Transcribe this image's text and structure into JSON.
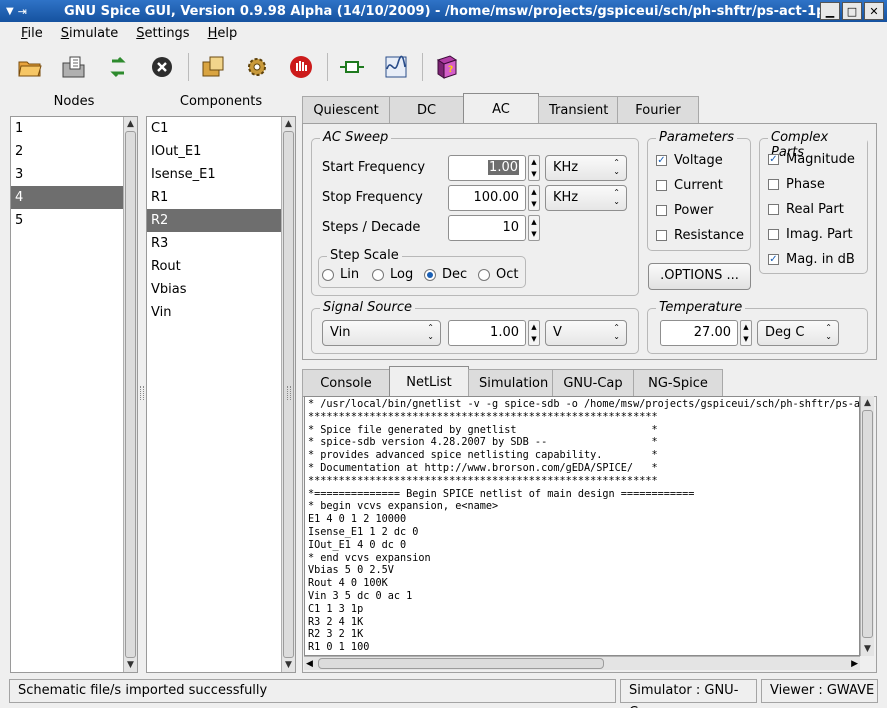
{
  "window": {
    "title": "GNU Spice GUI,  Version 0.9.98 Alpha (14/10/2009)  -  /home/msw/projects/gspiceui/sch/ph-shftr/ps-act-1p"
  },
  "menu": [
    "File",
    "Simulate",
    "Settings",
    "Help"
  ],
  "toolbar": {
    "icons": [
      "open-folder-icon",
      "import-icon",
      "reload-icon",
      "close-icon",
      "package-icon",
      "settings-gear-icon",
      "stop-hand-icon",
      "gnucap-icon",
      "waveform-viewer-icon",
      "help-book-icon"
    ]
  },
  "nodes": {
    "header": "Nodes",
    "items": [
      "1",
      "2",
      "3",
      "4",
      "5"
    ],
    "selected": "4"
  },
  "components": {
    "header": "Components",
    "items": [
      "C1",
      "IOut_E1",
      "Isense_E1",
      "R1",
      "R2",
      "R3",
      "Rout",
      "Vbias",
      "Vin"
    ],
    "selected": "R2"
  },
  "analysis_tabs": [
    "Quiescent",
    "DC",
    "AC",
    "Transient",
    "Fourier"
  ],
  "analysis_active": "AC",
  "ac_sweep": {
    "title": "AC Sweep",
    "start_label": "Start Frequency",
    "start_value": "1.00",
    "start_unit": "KHz",
    "stop_label": "Stop Frequency",
    "stop_value": "100.00",
    "stop_unit": "KHz",
    "steps_label": "Steps / Decade",
    "steps_value": "10",
    "step_scale": {
      "title": "Step Scale",
      "options": [
        "Lin",
        "Log",
        "Dec",
        "Oct"
      ],
      "selected": "Dec"
    }
  },
  "parameters": {
    "title": "Parameters",
    "items": [
      {
        "label": "Voltage",
        "checked": true
      },
      {
        "label": "Current",
        "checked": false
      },
      {
        "label": "Power",
        "checked": false
      },
      {
        "label": "Resistance",
        "checked": false
      }
    ]
  },
  "complex_parts": {
    "title": "Complex Parts",
    "items": [
      {
        "label": "Magnitude",
        "checked": true
      },
      {
        "label": "Phase",
        "checked": false
      },
      {
        "label": "Real Part",
        "checked": false
      },
      {
        "label": "Imag. Part",
        "checked": false
      },
      {
        "label": "Mag. in dB",
        "checked": true
      }
    ]
  },
  "options_button": ".OPTIONS ...",
  "signal_source": {
    "title": "Signal Source",
    "source": "Vin",
    "value": "1.00",
    "unit": "V"
  },
  "temperature": {
    "title": "Temperature",
    "value": "27.00",
    "unit": "Deg C"
  },
  "console_tabs": [
    "Console",
    "NetList",
    "Simulation",
    "GNU-Cap",
    "NG-Spice"
  ],
  "console_active": "NetList",
  "netlist_lines": [
    "* /usr/local/bin/gnetlist -v -g spice-sdb -o /home/msw/projects/gspiceui/sch/ph-shftr/ps-act-",
    "*********************************************************",
    "* Spice file generated by gnetlist                      *",
    "* spice-sdb version 4.28.2007 by SDB --                 *",
    "* provides advanced spice netlisting capability.        *",
    "* Documentation at http://www.brorson.com/gEDA/SPICE/   *",
    "*********************************************************",
    "*============== Begin SPICE netlist of main design ============",
    "* begin vcvs expansion, e<name>",
    "E1 4 0 1 2 10000",
    "Isense_E1 1 2 dc 0",
    "IOut_E1 4 0 dc 0",
    "* end vcvs expansion",
    "Vbias 5 0 2.5V",
    "Rout 4 0 100K",
    "Vin 3 5 dc 0 ac 1",
    "C1 1 3 1p",
    "R3 2 4 1K",
    "R2 3 2 1K",
    "R1 0 1 100"
  ],
  "status": {
    "message": "Schematic file/s imported successfully",
    "simulator": "Simulator : GNU-Cap",
    "viewer": "Viewer : GWAVE"
  }
}
